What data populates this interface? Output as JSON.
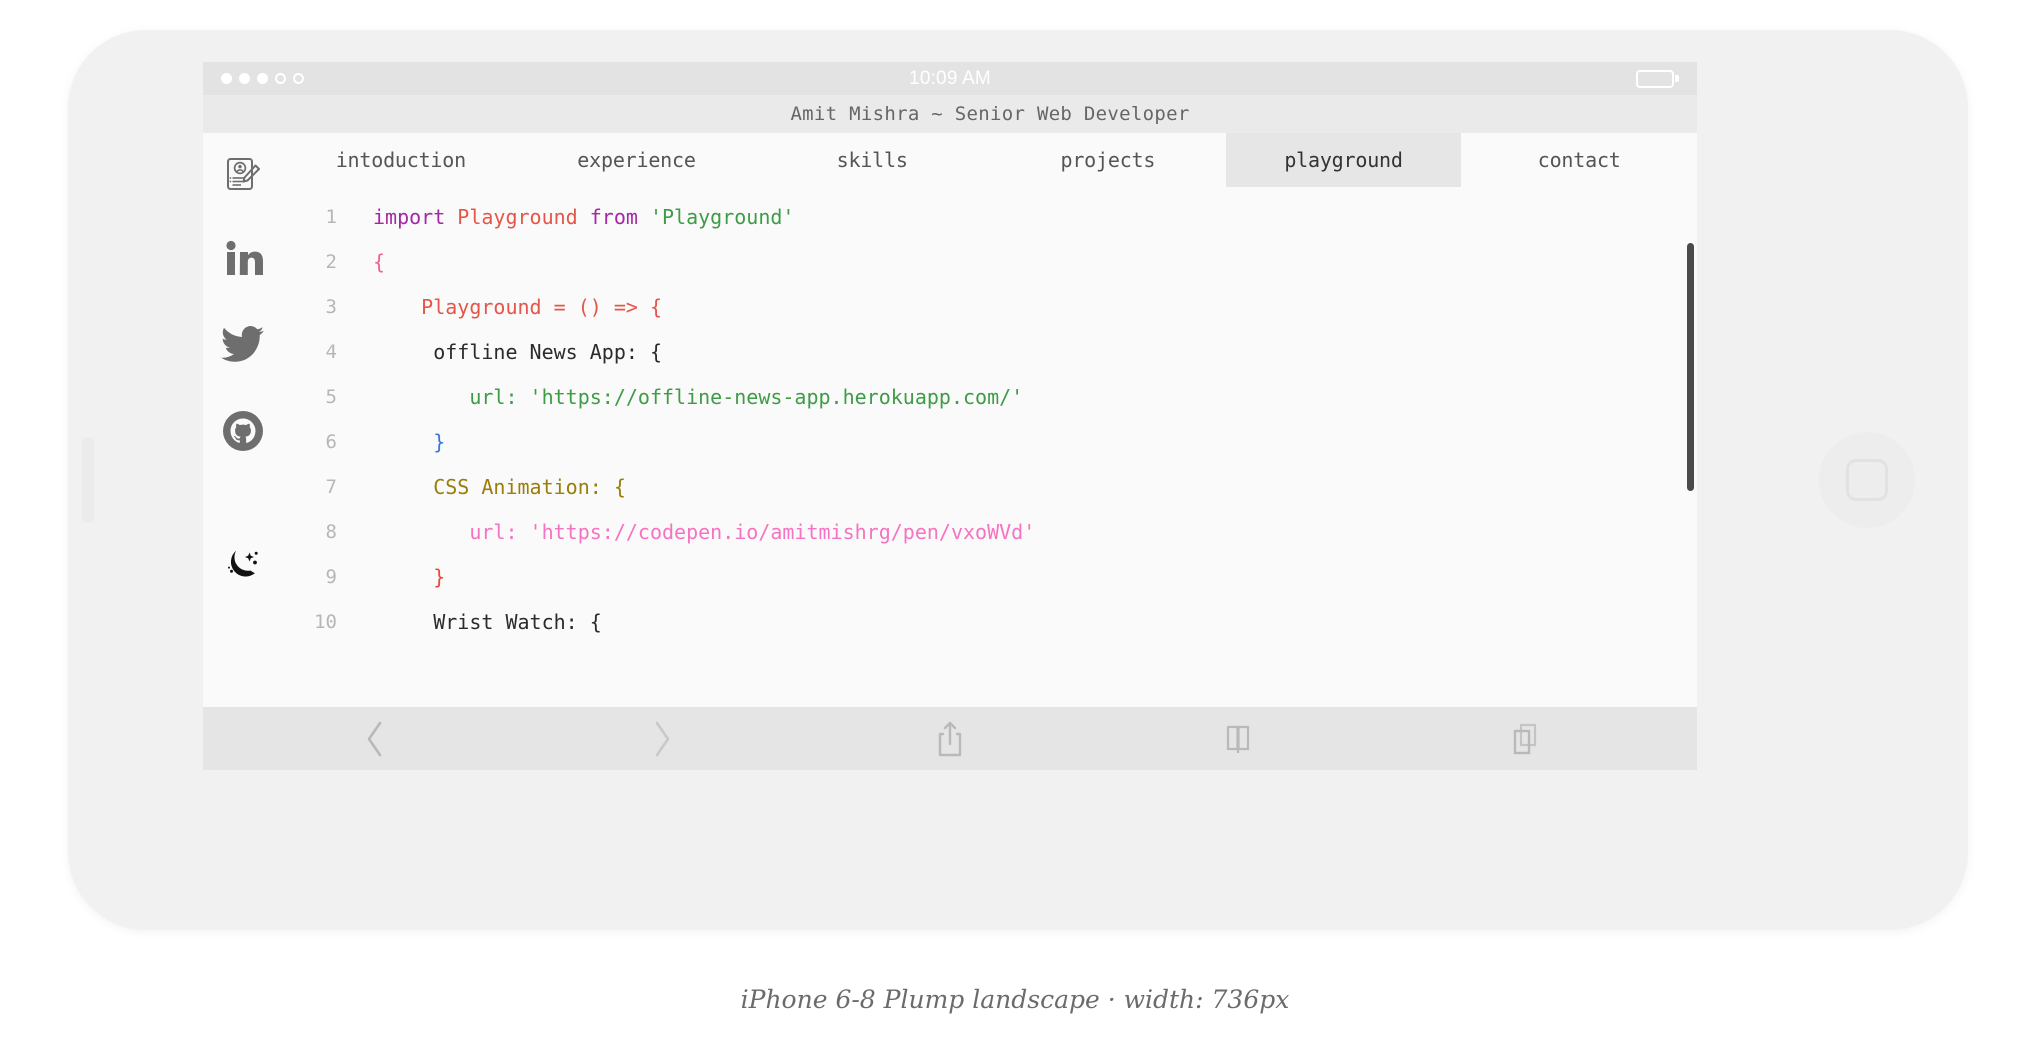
{
  "caption": "iPhone 6-8 Plump landscape · width: 736px",
  "status_bar": {
    "time": "10:09 AM",
    "signal_dots_filled": 3,
    "signal_dots_total": 5,
    "battery_icon": "battery-full-icon"
  },
  "site": {
    "title": "Amit Mishra ~ Senior Web Developer"
  },
  "sidebar": {
    "items": [
      {
        "icon": "resume-icon",
        "label": "resume"
      },
      {
        "icon": "linkedin-icon",
        "label": "linkedin"
      },
      {
        "icon": "twitter-icon",
        "label": "twitter"
      },
      {
        "icon": "github-icon",
        "label": "github"
      },
      {
        "icon": "moon-icon",
        "label": "dark-mode-toggle"
      }
    ]
  },
  "tabs": [
    {
      "label": "intoduction",
      "active": false
    },
    {
      "label": "experience",
      "active": false
    },
    {
      "label": "skills",
      "active": false
    },
    {
      "label": "projects",
      "active": false
    },
    {
      "label": "playground",
      "active": true
    },
    {
      "label": "contact",
      "active": false
    }
  ],
  "code": {
    "lines": [
      {
        "number": "1",
        "tokens": [
          {
            "text": "import ",
            "style": "t-keyword"
          },
          {
            "text": "Playground ",
            "style": "t-name"
          },
          {
            "text": "from ",
            "style": "t-keyword"
          },
          {
            "text": "'Playground'",
            "style": "t-string"
          }
        ]
      },
      {
        "number": "2",
        "tokens": [
          {
            "text": "{",
            "style": "t-brace-pink"
          }
        ]
      },
      {
        "number": "3",
        "tokens": [
          {
            "text": "    Playground = () => {",
            "style": "t-name"
          }
        ]
      },
      {
        "number": "4",
        "tokens": [
          {
            "text": "     offline News App: {",
            "style": "t-plain"
          }
        ]
      },
      {
        "number": "5",
        "tokens": [
          {
            "text": "        url: 'https://offline-news-app.herokuapp.com/'",
            "style": "t-string"
          }
        ]
      },
      {
        "number": "6",
        "tokens": [
          {
            "text": "     }",
            "style": "t-brace-blue"
          }
        ]
      },
      {
        "number": "7",
        "tokens": [
          {
            "text": "     CSS Animation: {",
            "style": "t-olive"
          }
        ]
      },
      {
        "number": "8",
        "tokens": [
          {
            "text": "        url: 'https://codepen.io/amitmishrg/pen/vxoWVd'",
            "style": "t-pink"
          }
        ]
      },
      {
        "number": "9",
        "tokens": [
          {
            "text": "     }",
            "style": "t-brace-red"
          }
        ]
      },
      {
        "number": "10",
        "tokens": [
          {
            "text": "     Wrist Watch: {",
            "style": "t-plain"
          }
        ]
      }
    ]
  },
  "safari_toolbar": {
    "buttons": [
      {
        "icon": "back-chevron-icon",
        "label": "Back"
      },
      {
        "icon": "forward-chevron-icon",
        "label": "Forward"
      },
      {
        "icon": "share-icon",
        "label": "Share"
      },
      {
        "icon": "bookmarks-icon",
        "label": "Bookmarks"
      },
      {
        "icon": "tabs-icon",
        "label": "Tabs"
      }
    ]
  },
  "colors": {
    "device_body": "#f1f1f1",
    "status_bar": "#e3e3e3",
    "title_bar": "#eaeaea",
    "active_tab": "#e6e6e6",
    "page_bg": "#fafafa",
    "keyword": "#a626a4",
    "name": "#e45649",
    "string": "#3f9c46",
    "pink": "#f573c2",
    "olive": "#9a7d0a",
    "brace_blue": "#3a76d8",
    "brace_red": "#e8493a"
  }
}
